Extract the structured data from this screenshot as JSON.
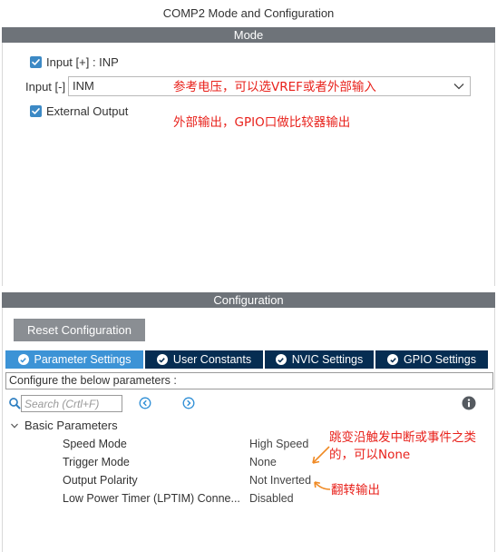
{
  "window": {
    "title": "COMP2 Mode and Configuration"
  },
  "mode": {
    "header": "Mode",
    "input_plus": {
      "label": "Input [+] : INP",
      "checked": true
    },
    "input_minus": {
      "label": "Input [-]",
      "value": "INM"
    },
    "external_output": {
      "label": "External Output",
      "checked": true
    },
    "annotations": {
      "vref": "参考电压，可以选VREF或者外部输入",
      "gpio": "外部输出，GPIO口做比较器输出"
    }
  },
  "configuration": {
    "header": "Configuration",
    "reset_label": "Reset Configuration",
    "tabs": [
      {
        "label": "Parameter Settings",
        "active": true
      },
      {
        "label": "User Constants",
        "active": false
      },
      {
        "label": "NVIC Settings",
        "active": false
      },
      {
        "label": "GPIO Settings",
        "active": false
      }
    ],
    "configure_text": "Configure the below parameters :",
    "search_placeholder": "Search (Crtl+F)",
    "group": "Basic Parameters",
    "params": [
      {
        "name": "Speed Mode",
        "value": "High Speed"
      },
      {
        "name": "Trigger Mode",
        "value": "None"
      },
      {
        "name": "Output Polarity",
        "value": "Not Inverted"
      },
      {
        "name": "Low Power Timer (LPTIM) Conne...",
        "value": "Disabled"
      }
    ],
    "annotations": {
      "trigger_line1": "跳变沿触发中断或事件之类",
      "trigger_line2": "的，可以None",
      "polarity": "翻转输出"
    }
  },
  "colors": {
    "header_bg": "#6e7379",
    "tab_bg": "#062d52",
    "tab_active_bg": "#3c93d6",
    "checkbox": "#3c89c5",
    "annotation": "#e8211b",
    "arrow": "#f08a24"
  },
  "icons": [
    "checkbox-checked-icon",
    "chevron-down-icon",
    "check-circle-icon",
    "search-icon",
    "arrow-left-circle-icon",
    "arrow-right-circle-icon",
    "info-icon",
    "expand-chevron-icon"
  ]
}
